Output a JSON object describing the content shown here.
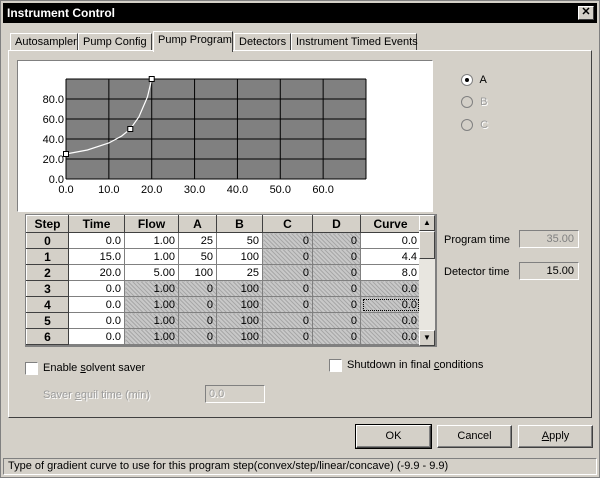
{
  "window": {
    "title": "Instrument Control",
    "close_glyph": "✕"
  },
  "tabs": [
    {
      "label": "Autosampler"
    },
    {
      "label": "Pump Config"
    },
    {
      "label": "Pump Program"
    },
    {
      "label": "Detectors"
    },
    {
      "label": "Instrument Timed Events"
    }
  ],
  "active_tab": "Pump Program",
  "chart_data": {
    "type": "line",
    "title": "",
    "xlabel": "",
    "ylabel": "",
    "x_ticks": [
      "0.0",
      "10.0",
      "20.0",
      "30.0",
      "40.0",
      "50.0",
      "60.0"
    ],
    "y_ticks": [
      "0.0",
      "20.0",
      "40.0",
      "60.0",
      "80.0"
    ],
    "xlim": [
      0,
      70
    ],
    "ylim": [
      0,
      100
    ],
    "grid": true,
    "series": [
      {
        "x": [
          0,
          5,
          10,
          13,
          15,
          17,
          19,
          20
        ],
        "y": [
          25,
          29,
          36,
          43,
          50,
          62,
          82,
          100
        ],
        "markers": [
          {
            "x": 0,
            "y": 25
          },
          {
            "x": 15,
            "y": 50
          },
          {
            "x": 20,
            "y": 100
          }
        ]
      }
    ]
  },
  "solvents": [
    {
      "label": "A",
      "checked": true,
      "enabled": true
    },
    {
      "label": "B",
      "checked": false,
      "enabled": false
    },
    {
      "label": "C",
      "checked": false,
      "enabled": false
    }
  ],
  "program_table": {
    "columns": [
      "Step",
      "Time",
      "Flow",
      "A",
      "B",
      "C",
      "D",
      "Curve"
    ],
    "rows": [
      {
        "step": "0",
        "time": "0.0",
        "flow": "1.00",
        "a": "25",
        "b": "50",
        "c": "0",
        "d": "0",
        "curve": "0.0"
      },
      {
        "step": "1",
        "time": "15.0",
        "flow": "1.00",
        "a": "50",
        "b": "100",
        "c": "0",
        "d": "0",
        "curve": "4.4"
      },
      {
        "step": "2",
        "time": "20.0",
        "flow": "5.00",
        "a": "100",
        "b": "25",
        "c": "0",
        "d": "0",
        "curve": "8.0"
      },
      {
        "step": "3",
        "time": "0.0",
        "flow": "1.00",
        "a": "0",
        "b": "100",
        "c": "0",
        "d": "0",
        "curve": "0.0"
      },
      {
        "step": "4",
        "time": "0.0",
        "flow": "1.00",
        "a": "0",
        "b": "100",
        "c": "0",
        "d": "0",
        "curve": "0.0"
      },
      {
        "step": "5",
        "time": "0.0",
        "flow": "1.00",
        "a": "0",
        "b": "100",
        "c": "0",
        "d": "0",
        "curve": "0.0"
      },
      {
        "step": "6",
        "time": "0.0",
        "flow": "1.00",
        "a": "0",
        "b": "100",
        "c": "0",
        "d": "0",
        "curve": "0.0"
      }
    ]
  },
  "program_time": {
    "label": "Program time",
    "value": "35.00"
  },
  "detector_time": {
    "label": "Detector time",
    "value": "15.00"
  },
  "solvent_saver": {
    "label_pre": "Enable ",
    "label_key": "s",
    "label_post": "olvent saver",
    "checked": false
  },
  "shutdown": {
    "label_pre": "Shutdown in final ",
    "label_key": "c",
    "label_post": "onditions",
    "checked": false
  },
  "saver_equil": {
    "label_pre": "Saver ",
    "label_key": "e",
    "label_post": "quil time (min)",
    "value": "0.0"
  },
  "buttons": {
    "ok": "OK",
    "cancel": "Cancel",
    "apply_key": "A",
    "apply_rest": "pply"
  },
  "status_text": "Type of gradient curve to use for this program step(convex/step/linear/concave) (-9.9 - 9.9)"
}
